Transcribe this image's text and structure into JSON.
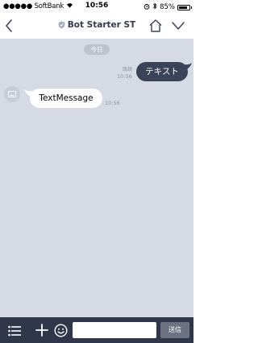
{
  "status_bar": {
    "signal": "●●●●●",
    "carrier": "SoftBank",
    "time": "10:56",
    "battery_text": "85%",
    "battery_level": 0.85
  },
  "header": {
    "title": "Bot Starter ST",
    "icons": [
      "back-chevron-icon",
      "shield-icon",
      "home-icon",
      "chevron-down-icon"
    ]
  },
  "chat": {
    "date_label": "今日",
    "messages": [
      {
        "direction": "outgoing",
        "text": "テキスト",
        "read_label": "既読",
        "time": "10:56"
      },
      {
        "direction": "incoming",
        "text": "TextMessage",
        "time": "10:56"
      }
    ]
  },
  "input_bar": {
    "placeholder": "",
    "value": "",
    "send_label": "送信",
    "icons": [
      "menu-list-icon",
      "plus-icon",
      "emoji-icon"
    ]
  },
  "colors": {
    "chat_background": "#d6dae4",
    "outgoing_bubble": "#3a4358",
    "input_bar": "#30374a",
    "send_button": "#6c7282"
  }
}
